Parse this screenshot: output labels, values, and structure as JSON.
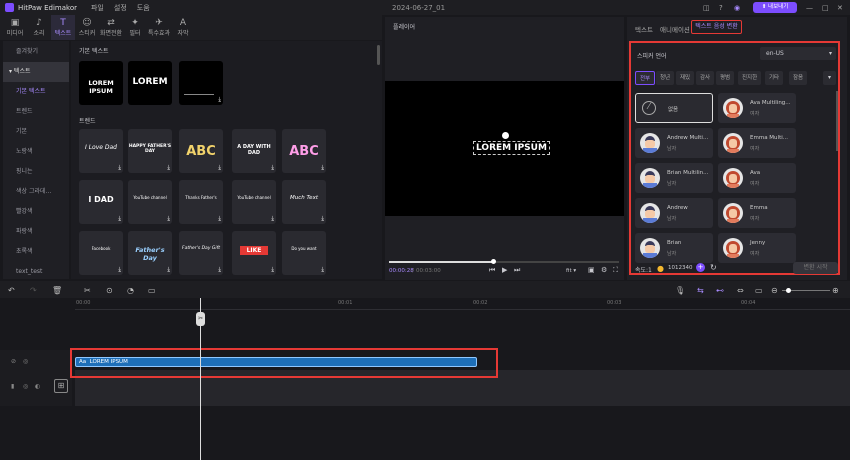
{
  "app": {
    "name": "HitPaw Edimakor",
    "menus": [
      "파일",
      "설정",
      "도움"
    ],
    "project_title": "2024-06-27_01",
    "export_label": "내보내기"
  },
  "toolbar": [
    {
      "label": "미디어",
      "icon": "media-icon"
    },
    {
      "label": "소리",
      "icon": "audio-icon"
    },
    {
      "label": "텍스트",
      "icon": "text-icon"
    },
    {
      "label": "스티커",
      "icon": "sticker-icon"
    },
    {
      "label": "화면전환",
      "icon": "transition-icon"
    },
    {
      "label": "필터",
      "icon": "filter-icon"
    },
    {
      "label": "특수효과",
      "icon": "effects-icon"
    },
    {
      "label": "자막",
      "icon": "subtitle-icon"
    }
  ],
  "sidebar": {
    "items": [
      "즐겨찾기",
      "텍스트",
      "기본 텍스트",
      "트렌드",
      "기본",
      "노랑색",
      "핑니는",
      "색상 그라데...",
      "빨강색",
      "파랑색",
      "초록색",
      "text_test"
    ]
  },
  "library": {
    "basic_header": "기본 텍스트",
    "basic_cards": [
      "LOREM IPSUM",
      "LOREM",
      ""
    ],
    "trend_header": "트렌드",
    "trend_cards": [
      "I Love Dad",
      "HAPPY FATHER'S DAY",
      "ABC",
      "A DAY WITH DAD",
      "ABC",
      "I DAD",
      "YouTube channel",
      "Thanks Father's",
      "YouTube channel",
      "Much Text",
      "Facebook",
      "Father's Day",
      "Father's Day Gift",
      "LIKE",
      "Do you want"
    ]
  },
  "player": {
    "title": "플레이어",
    "preview_text": "LOREM IPSUM",
    "time_current": "00:00:28",
    "time_total": "00:03:00",
    "zoom": "fit",
    "progress": 0.45
  },
  "right": {
    "tabs": [
      "텍스트",
      "애니메이션",
      "텍스트 음성 변환"
    ],
    "speaker_label": "스피커 언어",
    "language": "en-US",
    "categories": [
      "전부",
      "청년",
      "재밌",
      "감사",
      "평범",
      "진지한",
      "기타",
      "잠음"
    ],
    "voices": [
      {
        "name": "없음",
        "sub": ""
      },
      {
        "name": "Ava Multiling...",
        "sub": "여자"
      },
      {
        "name": "Andrew Multi...",
        "sub": "남자"
      },
      {
        "name": "Emma Multi...",
        "sub": "여자"
      },
      {
        "name": "Brian Multilin...",
        "sub": "남자"
      },
      {
        "name": "Ava",
        "sub": "여자"
      },
      {
        "name": "Andrew",
        "sub": "남자"
      },
      {
        "name": "Emma",
        "sub": "여자"
      },
      {
        "name": "Brian",
        "sub": "남자"
      },
      {
        "name": "Jenny",
        "sub": "여자"
      }
    ],
    "speed": "속도:1",
    "credits": "1012340",
    "apply": "변환 시작",
    "accent": "#7c4dff",
    "highlight": "#e53935"
  },
  "timeline": {
    "ruler": [
      "00:00",
      "00:01",
      "00:02",
      "00:03",
      "00:04"
    ],
    "clip_label": "LOREM IPSUM",
    "clip_prefix": "Aa"
  }
}
